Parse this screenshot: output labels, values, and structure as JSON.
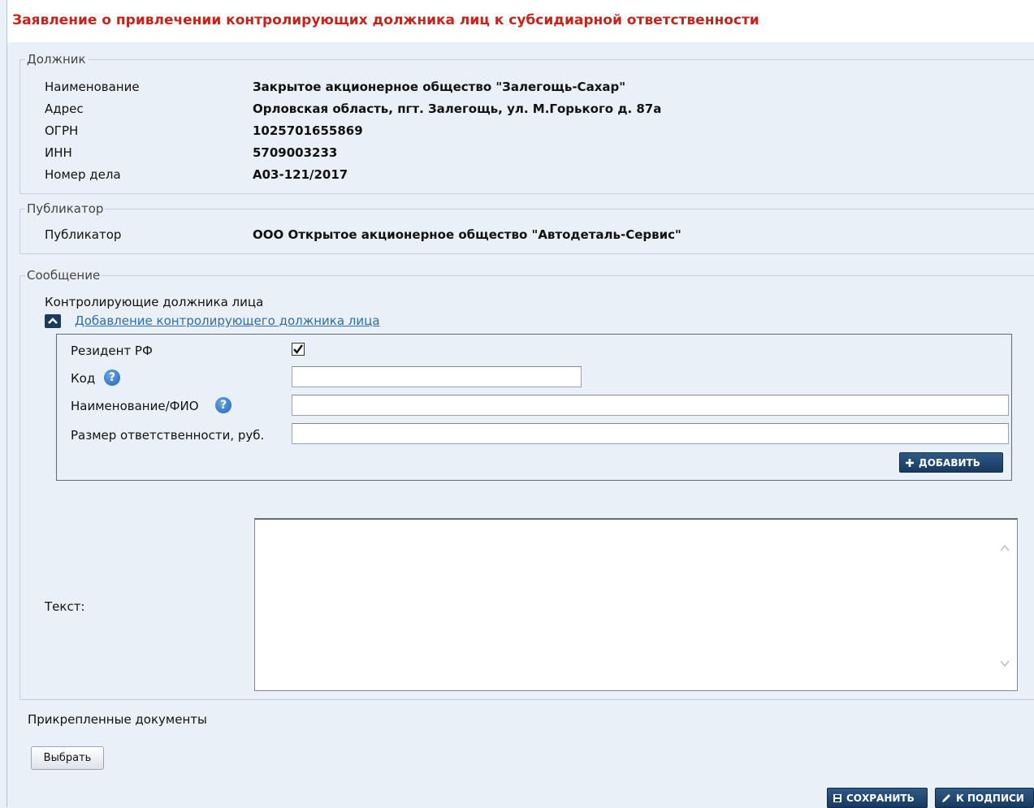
{
  "page": {
    "title": "Заявление о привлечении контролирующих должника лиц к субсидиарной ответственности"
  },
  "debtor": {
    "legend": "Должник",
    "rows": [
      {
        "label": "Наименование",
        "value": "Закрытое акционерное общество \"Залегощь-Сахар\""
      },
      {
        "label": "Адрес",
        "value": "Орловская область, пгт. Залегощь, ул. М.Горького д. 87а"
      },
      {
        "label": "ОГРН",
        "value": "1025701655869"
      },
      {
        "label": "ИНН",
        "value": "5709003233"
      },
      {
        "label": "Номер дела",
        "value": "А03-121/2017"
      }
    ]
  },
  "publisher": {
    "legend": "Публикатор",
    "label": "Публикатор",
    "value": "ООО Открытое акционерное общество \"Автодеталь-Сервис\""
  },
  "message": {
    "legend": "Сообщение",
    "section_label": "Контролирующие должника лица",
    "add_link": "Добавление контролирующего должника лица",
    "form": {
      "resident_label": "Резидент РФ",
      "resident_checked": true,
      "code_label": "Код",
      "code_value": "",
      "name_label": "Наименование/ФИО",
      "name_value": "",
      "amount_label": "Размер ответственности, руб.",
      "amount_value": "",
      "add_button": "ДОБАВИТЬ"
    },
    "text_label": "Текст:",
    "text_value": ""
  },
  "attachments": {
    "label": "Прикрепленные документы",
    "choose_button": "Выбрать"
  },
  "footer": {
    "save_button": "СОХРАНИТЬ",
    "sign_button": "К ПОДПИСИ"
  },
  "colors": {
    "title": "#c0261b",
    "background": "#e9f0f7",
    "link": "#2f6ea8",
    "button_dark": "#173a60"
  },
  "icons": {
    "collapse": "chevron-up-icon",
    "help": "help-icon",
    "add": "plus-icon",
    "save": "save-icon",
    "sign": "pencil-icon"
  }
}
